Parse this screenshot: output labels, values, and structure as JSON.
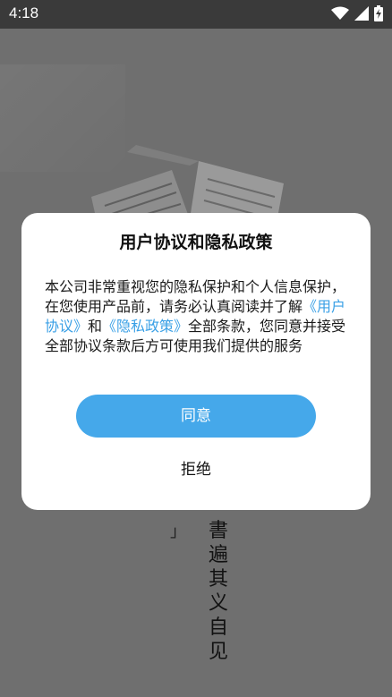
{
  "status_bar": {
    "time": "4:18",
    "icons": [
      "wifi-icon",
      "signal-icon",
      "battery-charging-icon"
    ]
  },
  "background": {
    "vertical_text": "書遍其义自见",
    "bracket_text": "」"
  },
  "dialog": {
    "title": "用户协议和隐私政策",
    "body_prefix": "本公司非常重视您的隐私保护和个人信息保护，在您使用产品前，请务必认真阅读并了解",
    "user_agreement_link": "《用户协议》",
    "and_text": "和",
    "privacy_policy_link": "《隐私政策》",
    "body_suffix": "全部条款，您同意并接受全部协议条款后方可使用我们提供的服务",
    "agree_label": "同意",
    "reject_label": "拒绝"
  },
  "colors": {
    "accent": "#45a8ea",
    "link": "#3aa0e6",
    "overlay": "#6b6b6b"
  }
}
